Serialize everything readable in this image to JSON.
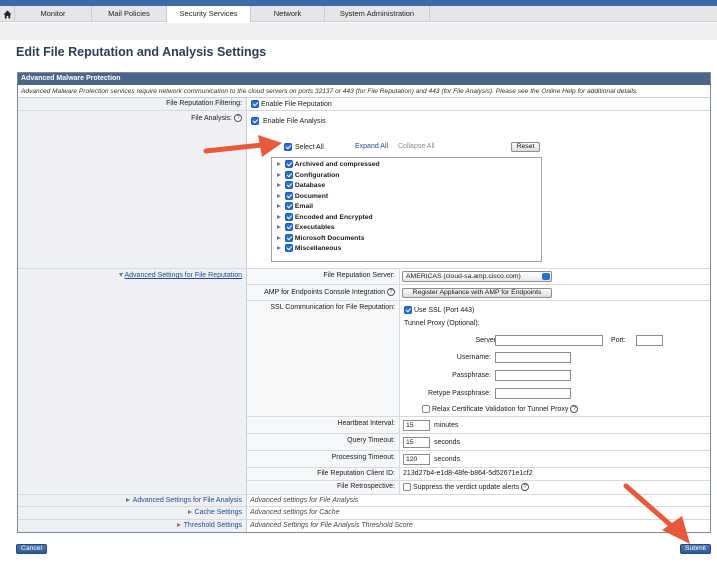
{
  "nav": {
    "tabs": [
      {
        "label": "Monitor"
      },
      {
        "label": "Mail Policies"
      },
      {
        "label": "Security Services"
      },
      {
        "label": "Network"
      },
      {
        "label": "System Administration"
      }
    ],
    "active": "Security Services"
  },
  "page": {
    "title": "Edit File Reputation and Analysis Settings"
  },
  "amp": {
    "header": "Advanced Malware Protection",
    "note": "Advanced Malware Protection services require network communication to the cloud servers on ports 32137 or 443 (for File Reputation) and 443 (for File Analysis). Please see the Online Help for additional details.",
    "file_reputation_filtering": {
      "label": "File Reputation Filtering:",
      "checkbox_label": "Enable File Reputation",
      "checked": true
    },
    "file_analysis": {
      "label": "File Analysis:",
      "help": "?",
      "checkbox_label": "Enable File Analysis",
      "checked": true,
      "select_all": "Select All",
      "expand_all": "Expand All",
      "collapse_all": "Collapse All",
      "reset": "Reset",
      "file_types": [
        {
          "label": "Archived and compressed"
        },
        {
          "label": "Configuration"
        },
        {
          "label": "Database"
        },
        {
          "label": "Document"
        },
        {
          "label": "Email"
        },
        {
          "label": "Encoded and Encrypted"
        },
        {
          "label": "Executables"
        },
        {
          "label": "Microsoft Documents"
        },
        {
          "label": "Miscellaneous"
        }
      ]
    }
  },
  "reputation_settings": {
    "section_link": "Advanced Settings for File Reputation",
    "server_label": "File Reputation Server:",
    "server_value": "AMERICAS (cloud-sa.amp.cisco.com)",
    "amp_console_label": "AMP for Endpoints Console Integration",
    "help": "?",
    "register_button": "Register Appliance with AMP for Endpoints",
    "ssl_label": "SSL Communication for File Reputation:",
    "use_ssl": "Use SSL (Port 443)",
    "tunnel_proxy": "Tunnel Proxy (Optional):",
    "server": "Server:",
    "port": "Port:",
    "username": "Username:",
    "passphrase": "Passphrase:",
    "retype_passphrase": "Retype Passphrase:",
    "relax_cert": "Relax Certificate Validation for Tunnel Proxy",
    "heartbeat_label": "Heartbeat Interval:",
    "heartbeat_value": "15",
    "heartbeat_unit": "minutes",
    "query_timeout_label": "Query Timeout:",
    "query_timeout_value": "15",
    "query_timeout_unit": "seconds",
    "processing_timeout_label": "Processing Timeout:",
    "processing_timeout_value": "120",
    "processing_timeout_unit": "seconds",
    "client_id_label": "File Reputation Client ID:",
    "client_id_value": "213d27b4-e1d8-48fe-b864-5d52671e1cf2",
    "retrospective_label": "File Retrospective:",
    "retrospective_checkbox": "Suppress the verdict update alerts"
  },
  "collapsed_sections": [
    {
      "link": "Advanced Settings for File Analysis",
      "desc": "Advanced settings for File Analysis"
    },
    {
      "link": "Cache Settings",
      "desc": "Advanced settings for Cache"
    },
    {
      "link": "Threshold Settings",
      "desc": "Advanced Settings for File Analysis Threshold Score"
    }
  ],
  "buttons": {
    "cancel": "Cancel",
    "submit": "Submit"
  },
  "colors": {
    "header": "#4a6587",
    "link": "#1a4d8f",
    "checkbox": "#2a6fd6",
    "annotation_arrow": "#e8593c"
  }
}
